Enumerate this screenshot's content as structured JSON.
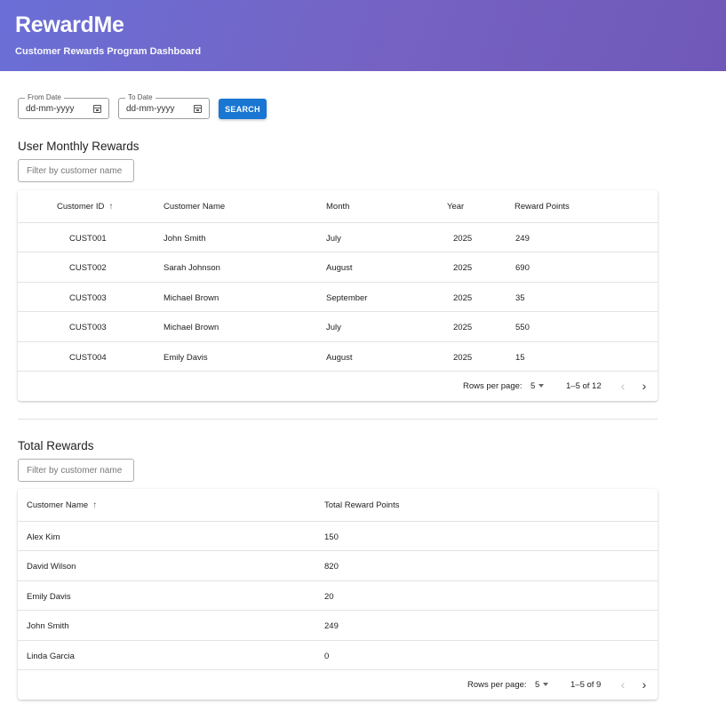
{
  "header": {
    "title": "RewardMe",
    "subtitle": "Customer Rewards Program Dashboard"
  },
  "filters": {
    "from_label": "From Date",
    "from_value": "dd-mm-yyyy",
    "to_label": "To Date",
    "to_value": "dd-mm-yyyy",
    "search_label": "SEARCH"
  },
  "monthly": {
    "title": "User Monthly Rewards",
    "filter_placeholder": "Filter by customer name",
    "columns": [
      "Customer ID",
      "Customer Name",
      "Month",
      "Year",
      "Reward Points"
    ],
    "sort_icon": "arrow-up-icon",
    "rows": [
      [
        "CUST001",
        "John Smith",
        "July",
        "2025",
        "249"
      ],
      [
        "CUST002",
        "Sarah Johnson",
        "August",
        "2025",
        "690"
      ],
      [
        "CUST003",
        "Michael Brown",
        "September",
        "2025",
        "35"
      ],
      [
        "CUST003",
        "Michael Brown",
        "July",
        "2025",
        "550"
      ],
      [
        "CUST004",
        "Emily Davis",
        "August",
        "2025",
        "15"
      ]
    ],
    "pagination": {
      "rows_label": "Rows per page:",
      "rows_value": "5",
      "range": "1–5 of 12"
    }
  },
  "total": {
    "title": "Total Rewards",
    "filter_placeholder": "Filter by customer name",
    "columns": [
      "Customer Name",
      "Total Reward Points"
    ],
    "sort_icon": "arrow-up-icon",
    "rows": [
      [
        "Alex Kim",
        "150"
      ],
      [
        "David Wilson",
        "820"
      ],
      [
        "Emily Davis",
        "20"
      ],
      [
        "John Smith",
        "249"
      ],
      [
        "Linda Garcia",
        "0"
      ]
    ],
    "pagination": {
      "rows_label": "Rows per page:",
      "rows_value": "5",
      "range": "1–5 of 9"
    }
  },
  "icons": {
    "prev": "chevron-left-icon",
    "next": "chevron-right-icon",
    "calendar": "calendar-icon"
  },
  "colors": {
    "header_start": "#6a6fd6",
    "header_end": "#6f58b8",
    "primary_button": "#1976d2"
  }
}
